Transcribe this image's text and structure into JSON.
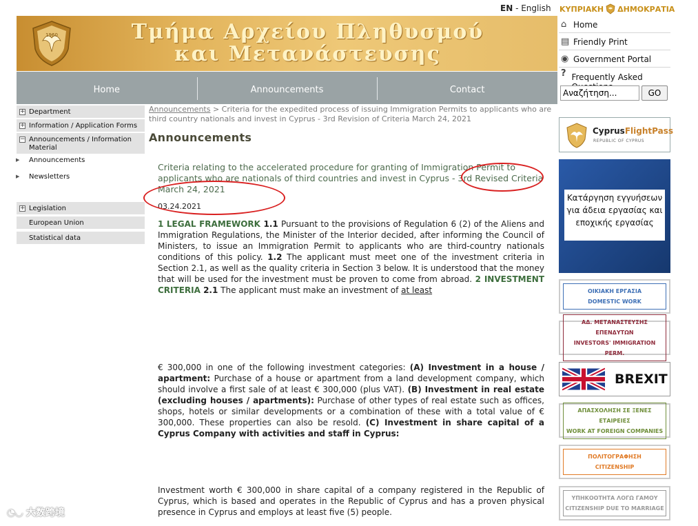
{
  "top": {
    "lang_code": "EN",
    "lang_separator": " - ",
    "lang_name": "English",
    "republic_left": "ΚΥΠΡΙΑΚΗ",
    "republic_right": "ΔΗΜΟΚΡΑΤΙΑ"
  },
  "banner": {
    "line1": "Τμήμα Αρχείου Πληθυσμού",
    "line2": "και Μετανάστευσης"
  },
  "nav": [
    "Home",
    "Announcements",
    "Contact"
  ],
  "utility": [
    {
      "label": "Home",
      "icon": "house-icon"
    },
    {
      "label": "Friendly Print",
      "icon": "printer-icon"
    },
    {
      "label": "Government Portal",
      "icon": "globe-icon"
    },
    {
      "label": "Frequently Asked Questions",
      "icon": "question-icon"
    }
  ],
  "search": {
    "value": "Αναζήτηση...",
    "button": "GO"
  },
  "sidebar": {
    "department": "Department",
    "forms": "Information / Application Forms",
    "announcements_material": "Announcements / Information Material",
    "announcements": "Announcements",
    "newsletters": "Newsletters",
    "legislation": "Legislation",
    "eu": "European Union",
    "stats": "Statistical data",
    "plus": "+",
    "minus": "−"
  },
  "content": {
    "breadcrumb_link": "Announcements",
    "breadcrumb_rest": " > Criteria for the expedited process of issuing Immigration Permits to applicants who are third country nationals and invest in Cyprus - 3rd Revision of Criteria March 24, 2021",
    "heading": "Announcements",
    "lead": "Criteria relating to the accelerated procedure for granting of Immigration Permit to applicants who are nationals of third countries and invest in Cyprus - 3rd Revised Criteria March 24, 2021",
    "date": "03.24.2021",
    "p1": {
      "s1_head": "1 LEGAL FRAMEWORK",
      "s1_num": " 1.1",
      "s1_text": "   Pursuant to the provisions of Regulation 6 (2) of the Aliens and Immigration Regulations, the Minister of the Interior decided, after informing the Council of Ministers, to issue an Immigration Permit to applicants who are third-country nationals conditions of this policy. ",
      "s2_num": "1.2",
      "s2_text": "   The applicant must meet one of the investment criteria in Section 2.1, as well as the quality criteria in Section 3 below. It is understood that the money that will be used for the investment must be proven to come from abroad. ",
      "s3_head": "2 INVESTMENT CRITERIA",
      "s3_num": " 2.1",
      "s3_text": "   The applicant must make an investment of ",
      "s3_underline": "at least"
    },
    "p2": {
      "t1": "€ 300,000 in one of the following investment categories: ",
      "a_head": "(A) Investment in a house / apartment:",
      "a_text": " Purchase of a house or apartment from a land development company, which should involve a first sale of at least € 300,000 (plus VAT). ",
      "b_head": "(B) Investment in real estate (excluding houses / apartments):",
      "b_text": " Purchase of other types of real estate such as offices, shops, hotels or similar developments or a combination of these with a total value of € 300,000. These properties can also be resold. ",
      "c_head": "(C) Investment in share capital of a Cyprus Company with activities and staff in Cyprus:"
    },
    "p3": "Investment worth € 300,000 in share capital of a company registered in the Republic of Cyprus, which is based and operates in the Republic of Cyprus and has a proven physical presence in Cyprus and employs at least five (5) people."
  },
  "right": {
    "flightpass_name1": "Cyprus",
    "flightpass_name2": "FlightPass",
    "flightpass_sub": "REPUBLIC OF CYPRUS",
    "abolish": "Κατάργηση εγγυήσεων για άδεια εργασίας και εποχικής εργασίας",
    "tiles": [
      {
        "gr": "ΟΙΚΙΑΚΗ ΕΡΓΑΣΙΑ",
        "en": "DOMESTIC WORK",
        "color": "#3d6fb5"
      },
      {
        "gr": "ΑΔ. ΜΕΤΑΝΑΣΤΕΥΣΗΣ ΕΠΕΝΔΥΤΩΝ",
        "en": "INVESTORS' IMMIGRATION PERM.",
        "color": "#8e2a3a"
      },
      {
        "gr": "ΑΠΑΣΧΟΛΗΣΗ ΣΕ ΞΕΝΕΣ ΕΤΑΙΡΕΙΕΣ",
        "en": "WORK AT FOREIGN COMPANIES",
        "color": "#6f8e3a"
      },
      {
        "gr": "ΠΟΛΙΤΟΓΡΑΦΗΣΗ",
        "en": "CITIZENSHIP",
        "color": "#e07a25"
      },
      {
        "gr": "ΥΠΗΚΟΟΤΗΤΑ ΛΟΓΩ ΓΑΜΟΥ",
        "en": "CITIZENSHIP DUE TO MARRIAGE",
        "color": "#9a9a9a"
      }
    ],
    "brexit": "BREXIT"
  },
  "watermark": "大数跨境"
}
